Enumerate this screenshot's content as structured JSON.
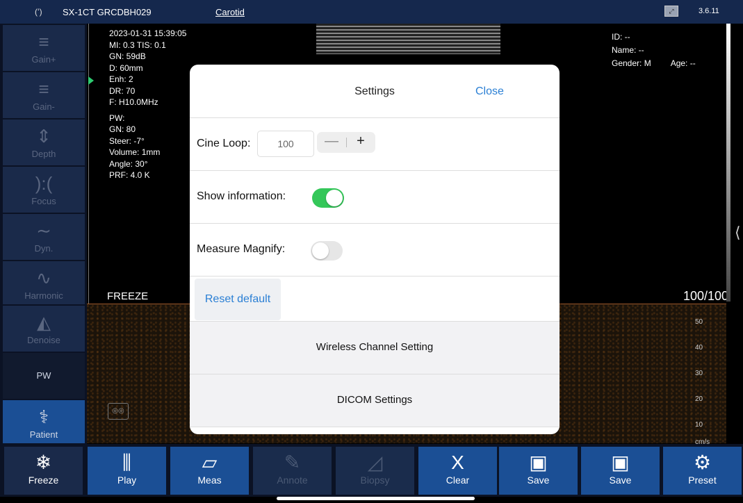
{
  "topbar": {
    "signal_icon": "(ʻ)",
    "device": "SX-1CT GRCDBH029",
    "preset": "Carotid",
    "version": "3.6.11"
  },
  "left_controls": [
    {
      "label": "Gain+",
      "icon": "≡"
    },
    {
      "label": "Gain-",
      "icon": "≡"
    },
    {
      "label": "Depth",
      "icon": "⇕"
    },
    {
      "label": "Focus",
      "icon": "):("
    },
    {
      "label": "Dyn.",
      "icon": "∼"
    },
    {
      "label": "Harmonic",
      "icon": "∿"
    },
    {
      "label": "Denoise",
      "icon": "◭"
    },
    {
      "label": "PW",
      "icon": ""
    },
    {
      "label": "Patient",
      "icon": "⚕"
    }
  ],
  "info": [
    "2023-01-31 15:39:05",
    "MI: 0.3  TIS: 0.1",
    "GN: 59dB",
    "D: 60mm",
    "Enh: 2",
    "DR: 70",
    "F: H10.0MHz",
    "PW:",
    "GN: 80",
    "Steer: -7°",
    "Volume: 1mm",
    "Angle: 30°",
    "PRF: 4.0 K"
  ],
  "patient": {
    "id": "ID: --",
    "name": "Name: --",
    "gender": "Gender: M",
    "age": "Age: --"
  },
  "freeze_label": "FREEZE",
  "cine_counter": "100/100",
  "velocity_ticks": [
    "50",
    "40",
    "30",
    "20",
    "10",
    "cm/s"
  ],
  "toolbar": [
    {
      "label": "Freeze",
      "icon": "❄",
      "enabled": true
    },
    {
      "label": "Play",
      "icon": "⫼",
      "enabled": true
    },
    {
      "label": "Meas",
      "icon": "▱",
      "enabled": true
    },
    {
      "label": "Annote",
      "icon": "✎",
      "enabled": false
    },
    {
      "label": "Biopsy",
      "icon": "◿",
      "enabled": false
    },
    {
      "label": "Clear",
      "icon": "X",
      "enabled": true
    },
    {
      "label": "Save",
      "icon": "▣",
      "enabled": true
    },
    {
      "label": "Save",
      "icon": "▣",
      "enabled": true
    },
    {
      "label": "Preset",
      "icon": "⚙",
      "enabled": true
    }
  ],
  "settings": {
    "title": "Settings",
    "close": "Close",
    "cine_loop_label": "Cine Loop:",
    "cine_loop_value": "100",
    "stepper_minus": "—",
    "stepper_plus": "+",
    "show_info_label": "Show information:",
    "show_info_on": true,
    "measure_magnify_label": "Measure Magnify:",
    "measure_magnify_on": false,
    "reset_default": "Reset default",
    "wireless": "Wireless Channel Setting",
    "dicom": "DICOM Settings"
  }
}
